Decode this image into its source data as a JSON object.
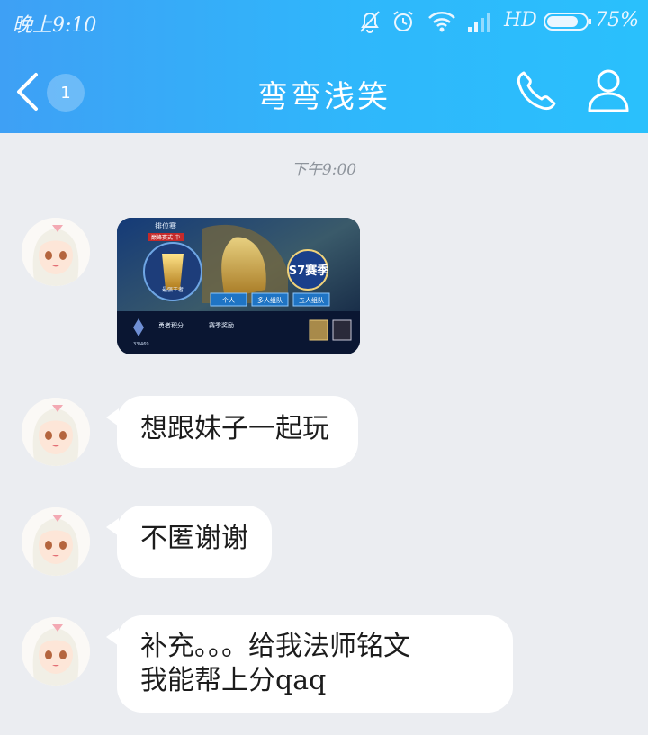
{
  "status_bar": {
    "time": "晚上9:10",
    "network": "HD",
    "battery": "75%"
  },
  "nav": {
    "back_icon": "chevron-left-icon",
    "unread_count": "1",
    "contact_name": "弯弯浅笑",
    "call_icon": "phone-icon",
    "profile_icon": "person-icon"
  },
  "chat": {
    "timestamp": "下午9:00",
    "messages": [
      {
        "type": "image",
        "game": {
          "mode_title": "排位赛",
          "mode_tag": "巅峰赛式 中",
          "rank_name": "最强王者",
          "season_badge": "S7赛季",
          "btn_single": "个人",
          "btn_group": "多人组队",
          "btn_five": "五人组队",
          "score_label": "勇者积分",
          "score_value": "33/469",
          "reward_label": "赛季奖励"
        }
      },
      {
        "type": "text",
        "text": "想跟妹子一起玩"
      },
      {
        "type": "text",
        "text": "不匿谢谢"
      },
      {
        "type": "text",
        "lines": [
          "补充。。。给我法师铭文",
          "我能帮上分qaq"
        ]
      }
    ]
  },
  "colors": {
    "header_start": "#3ea0f5",
    "header_end": "#2ac0fc",
    "background": "#ebedf1",
    "bubble": "#ffffff"
  }
}
